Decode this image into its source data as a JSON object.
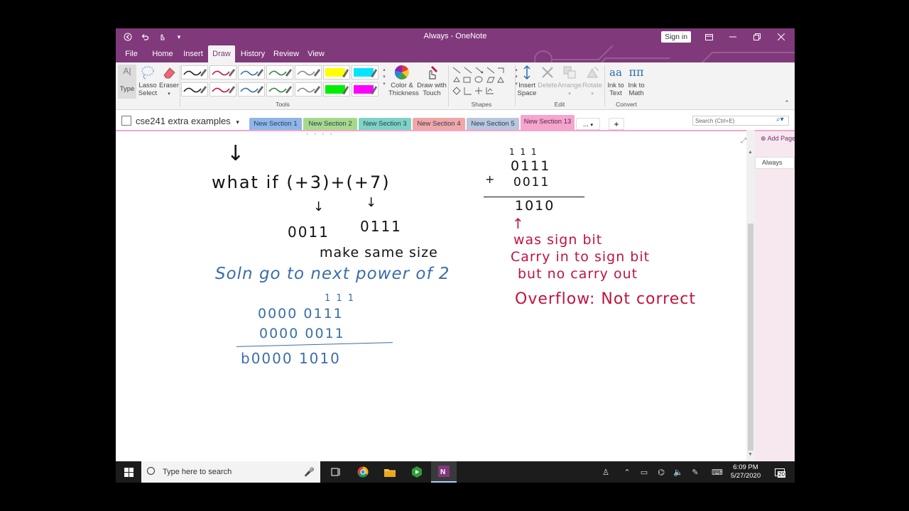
{
  "window": {
    "title": "Always  -  OneNote",
    "sign_in_label": "Sign in",
    "accent": "#80397B"
  },
  "menu": {
    "tabs": [
      "File",
      "Home",
      "Insert",
      "Draw",
      "History",
      "Review",
      "View"
    ],
    "active": "Draw"
  },
  "ribbon": {
    "type_label": "Type",
    "lasso_label_1": "Lasso",
    "lasso_label_2": "Select",
    "eraser_label": "Eraser",
    "color_label_1": "Color &",
    "color_label_2": "Thickness",
    "drawtouch_label_1": "Draw with",
    "drawtouch_label_2": "Touch",
    "insert_space_1": "Insert",
    "insert_space_2": "Space",
    "delete_label": "Delete",
    "arrange_label": "Arrange",
    "rotate_label": "Rotate",
    "ink_text_1": "Ink to",
    "ink_text_2": "Text",
    "ink_math_1": "Ink to",
    "ink_math_2": "Math",
    "groups": {
      "tools": "Tools",
      "shapes": "Shapes",
      "edit": "Edit",
      "convert": "Convert"
    },
    "pens": [
      {
        "color": "#222222"
      },
      {
        "color": "#c0143c"
      },
      {
        "color": "#3a6ea8"
      },
      {
        "color": "#2e8b3e"
      },
      {
        "color": "#888888"
      },
      {
        "color": "#ffff00"
      },
      {
        "color": "#00e5ff"
      },
      {
        "color": "#222222"
      },
      {
        "color": "#c0143c"
      },
      {
        "color": "#3a6ea8"
      },
      {
        "color": "#2e8b3e"
      },
      {
        "color": "#888888"
      },
      {
        "color": "#00ee00"
      },
      {
        "color": "#ff00ff"
      }
    ]
  },
  "notebook": {
    "name": "cse241 extra examples",
    "sections": [
      {
        "label": "New Section 1",
        "color": "#8FB6E8"
      },
      {
        "label": "New Section 2",
        "color": "#A8D98A"
      },
      {
        "label": "New Section 3",
        "color": "#7ED3C4"
      },
      {
        "label": "New Section 4",
        "color": "#F2A7A7"
      },
      {
        "label": "New Section 5",
        "color": "#B9C6DD"
      },
      {
        "label": "New Section 13",
        "color": "#F4A6CC"
      }
    ],
    "more_label": "...",
    "add_label": "+",
    "search_placeholder": "Search (Ctrl+E)"
  },
  "pages": {
    "add_page_label": "Add Page",
    "items": [
      "Always"
    ]
  },
  "ink": {
    "arrow_down": "↓",
    "whatif": "what if (+3)+(+7)",
    "down1": "↓",
    "down2": "↓",
    "bin3": "0011",
    "bin7": "0111",
    "same_size": "make same size",
    "soln": "Soln go to next power of 2",
    "carries_left": "1 1 1",
    "row1": "0000 0111",
    "row2": "0000 0011",
    "sum": "b0000 1010",
    "carries_right": "1 1 1",
    "add_top": "0111",
    "plus": "+",
    "add_bottom": "0011",
    "add_result": "1010",
    "up_arrow": "↑",
    "note1": "was sign bit",
    "note2": "Carry in to sign bit",
    "note3": "but no carry out",
    "note4": "Overflow: Not correct"
  },
  "taskbar": {
    "search_placeholder": "Type here to search",
    "time": "6:09 PM",
    "date": "5/27/2020",
    "notifications": "20"
  }
}
